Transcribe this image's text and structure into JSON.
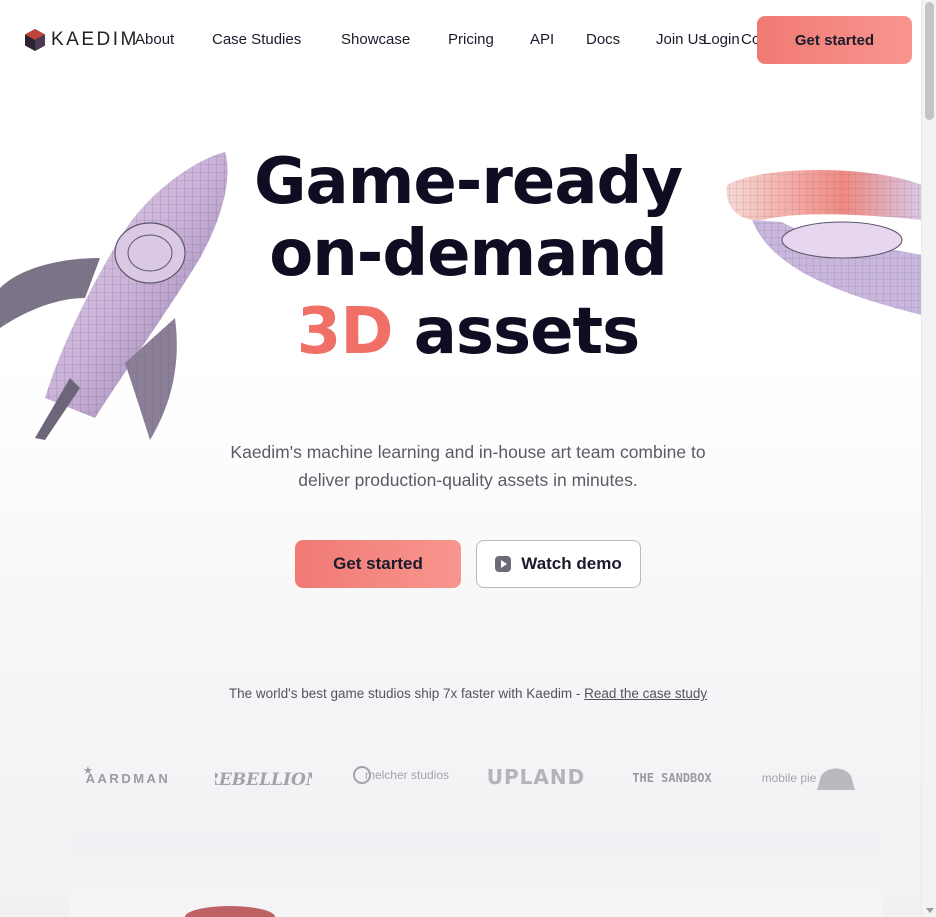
{
  "nav": {
    "brand": "KAEDIM",
    "links": [
      "About",
      "Case Studies",
      "Showcase",
      "Pricing",
      "API",
      "Docs",
      "Join Us",
      "Login",
      "Contact"
    ],
    "cta": "Get started"
  },
  "hero": {
    "line1": "Game-ready",
    "line2": "on-demand",
    "line3_accent": "3D",
    "line3_rest": "assets",
    "subtitle": "Kaedim's machine learning and in-house art team combine to deliver production-quality assets in minutes.",
    "primary_cta": "Get started",
    "secondary_cta": "Watch demo"
  },
  "social_proof": {
    "text": "The world's best game studios ship 7x faster with Kaedim - ",
    "link": "Read the case study",
    "studios": [
      "AARDMAN",
      "REBELLION",
      "melcher studios",
      "UPLAND",
      "THE SANDBOX",
      "mobile pie"
    ]
  },
  "colors": {
    "accent": "#f07068",
    "primary_text": "#0f0d21"
  },
  "icons": [
    "kaedim-logo-icon",
    "play-icon"
  ]
}
